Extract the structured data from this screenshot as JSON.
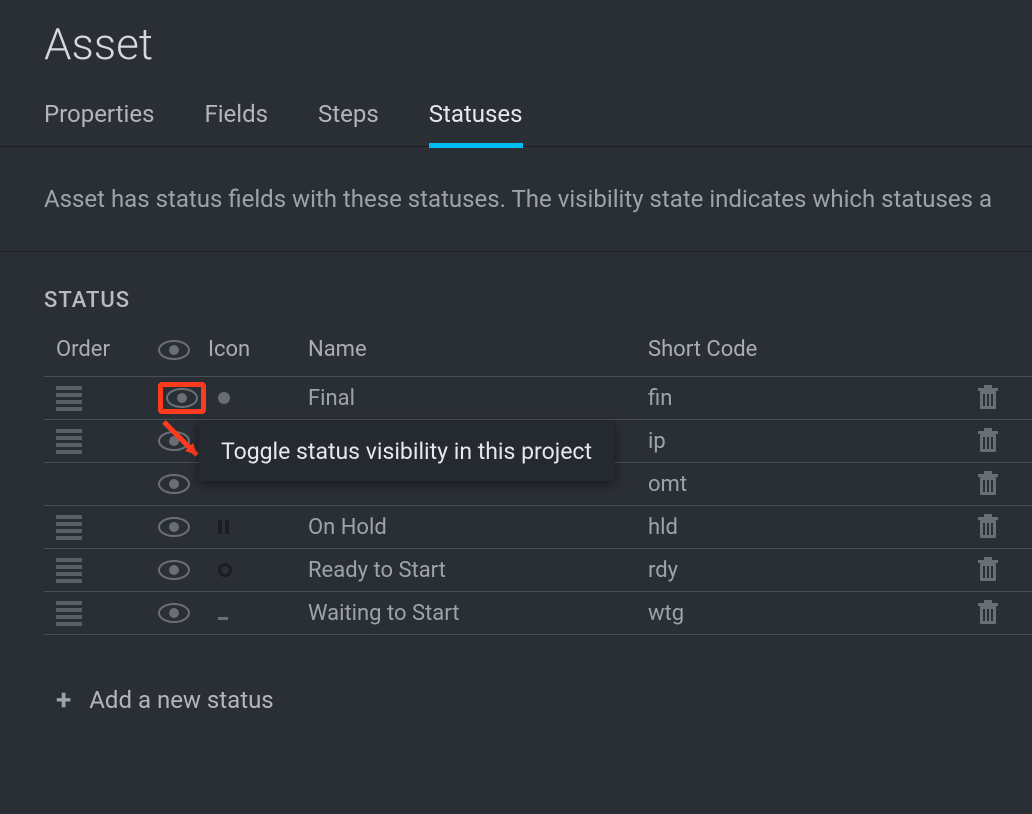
{
  "page_title": "Asset",
  "tabs": [
    {
      "label": "Properties",
      "active": false
    },
    {
      "label": "Fields",
      "active": false
    },
    {
      "label": "Steps",
      "active": false
    },
    {
      "label": "Statuses",
      "active": true
    }
  ],
  "description": "Asset has status fields with these statuses. The visibility state indicates which statuses a",
  "section_title": "STATUS",
  "columns": {
    "order": "Order",
    "icon": "Icon",
    "name": "Name",
    "short_code": "Short Code"
  },
  "rows": [
    {
      "name": "Final",
      "code": "fin",
      "highlighted": true,
      "icon_type": "dot"
    },
    {
      "name": "",
      "code": "ip",
      "highlighted": false,
      "icon_type": "dash"
    },
    {
      "name": "",
      "code": "omt",
      "highlighted": false,
      "icon_type": "blank"
    },
    {
      "name": "On Hold",
      "code": "hld",
      "highlighted": false,
      "icon_type": "pause"
    },
    {
      "name": "Ready to Start",
      "code": "rdy",
      "highlighted": false,
      "icon_type": "circle"
    },
    {
      "name": "Waiting to Start",
      "code": "wtg",
      "highlighted": false,
      "icon_type": "underscore"
    }
  ],
  "tooltip": "Toggle status visibility in this project",
  "add_label": "Add a new status"
}
